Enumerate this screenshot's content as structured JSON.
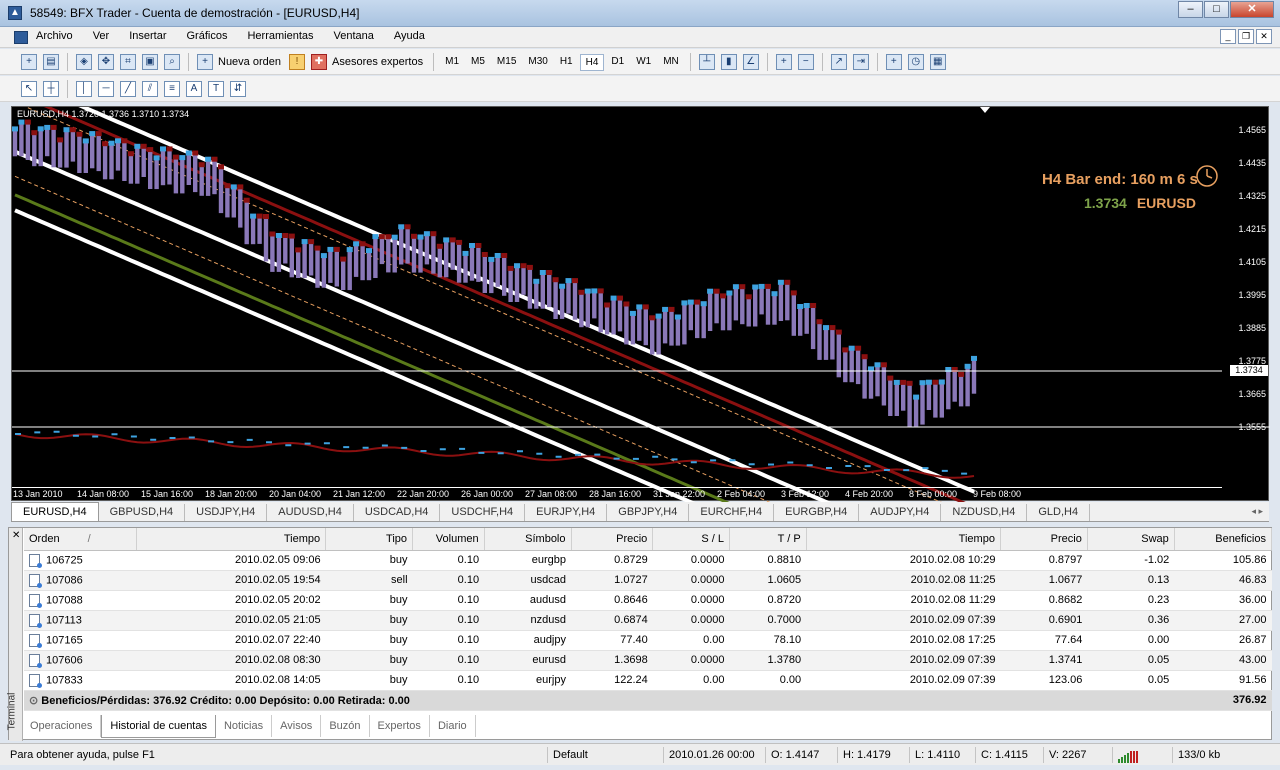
{
  "window": {
    "title": "58549: BFX Trader - Cuenta de demostración - [EURUSD,H4]"
  },
  "menu": [
    "Archivo",
    "Ver",
    "Insertar",
    "Gráficos",
    "Herramientas",
    "Ventana",
    "Ayuda"
  ],
  "toolbar": {
    "new_order": "Nueva orden",
    "expert_advisors": "Asesores expertos",
    "timeframes": [
      "M1",
      "M5",
      "M15",
      "M30",
      "H1",
      "H4",
      "D1",
      "W1",
      "MN"
    ],
    "active_timeframe": "H4"
  },
  "chart": {
    "header": "EURUSD,H4  1.3720 1.3736 1.3710 1.3734",
    "bar_end": "H4 Bar end: 160 m 6 s",
    "last_price": "1.3734",
    "last_symbol": "EURUSD",
    "current_price_label": "1.3734",
    "y_ticks": [
      "1.4565",
      "1.4435",
      "1.4325",
      "1.4215",
      "1.4105",
      "1.3995",
      "1.3885",
      "1.3775",
      "1.3665",
      "1.3555"
    ],
    "x_ticks": [
      "13 Jan 2010",
      "14 Jan 08:00",
      "15 Jan 16:00",
      "18 Jan 20:00",
      "20 Jan 04:00",
      "21 Jan 12:00",
      "22 Jan 20:00",
      "26 Jan 00:00",
      "27 Jan 08:00",
      "28 Jan 16:00",
      "31 Jan 22:00",
      "2 Feb 04:00",
      "3 Feb 12:00",
      "4 Feb 20:00",
      "8 Feb 00:00",
      "9 Feb 08:00"
    ],
    "colors": {
      "bull": "#3ea3e0",
      "bear": "#8b1010",
      "body": "#8a78b8",
      "band": "#ffffff",
      "green": "#5a7a1a"
    }
  },
  "chart_data": {
    "type": "line",
    "title": "EURUSD,H4",
    "ylim": [
      1.3555,
      1.4565
    ],
    "x": [
      "13 Jan 2010",
      "14 Jan 08:00",
      "15 Jan 16:00",
      "18 Jan 20:00",
      "20 Jan 04:00",
      "21 Jan 12:00",
      "22 Jan 20:00",
      "26 Jan 00:00",
      "27 Jan 08:00",
      "28 Jan 16:00",
      "31 Jan 22:00",
      "2 Feb 04:00",
      "3 Feb 12:00",
      "4 Feb 20:00",
      "8 Feb 00:00",
      "9 Feb 08:00"
    ],
    "series": [
      {
        "name": "EURUSD",
        "values": [
          1.45,
          1.447,
          1.442,
          1.439,
          1.415,
          1.408,
          1.416,
          1.411,
          1.403,
          1.396,
          1.388,
          1.396,
          1.398,
          1.378,
          1.364,
          1.3734
        ]
      }
    ]
  },
  "symbol_tabs": [
    "EURUSD,H4",
    "GBPUSD,H4",
    "USDJPY,H4",
    "AUDUSD,H4",
    "USDCAD,H4",
    "USDCHF,H4",
    "EURJPY,H4",
    "GBPJPY,H4",
    "EURCHF,H4",
    "EURGBP,H4",
    "AUDJPY,H4",
    "NZDUSD,H4",
    "GLD,H4"
  ],
  "terminal": {
    "side_label": "Terminal",
    "columns": [
      "Orden",
      "Tiempo",
      "Tipo",
      "Volumen",
      "Símbolo",
      "Precio",
      "S / L",
      "T / P",
      "Tiempo",
      "Precio",
      "Swap",
      "Beneficios"
    ],
    "sort_indicator": "/",
    "rows": [
      [
        "106725",
        "2010.02.05 09:06",
        "buy",
        "0.10",
        "eurgbp",
        "0.8729",
        "0.0000",
        "0.8810",
        "2010.02.08 10:29",
        "0.8797",
        "-1.02",
        "105.86"
      ],
      [
        "107086",
        "2010.02.05 19:54",
        "sell",
        "0.10",
        "usdcad",
        "1.0727",
        "0.0000",
        "1.0605",
        "2010.02.08 11:25",
        "1.0677",
        "0.13",
        "46.83"
      ],
      [
        "107088",
        "2010.02.05 20:02",
        "buy",
        "0.10",
        "audusd",
        "0.8646",
        "0.0000",
        "0.8720",
        "2010.02.08 11:29",
        "0.8682",
        "0.23",
        "36.00"
      ],
      [
        "107113",
        "2010.02.05 21:05",
        "buy",
        "0.10",
        "nzdusd",
        "0.6874",
        "0.0000",
        "0.7000",
        "2010.02.09 07:39",
        "0.6901",
        "0.36",
        "27.00"
      ],
      [
        "107165",
        "2010.02.07 22:40",
        "buy",
        "0.10",
        "audjpy",
        "77.40",
        "0.00",
        "78.10",
        "2010.02.08 17:25",
        "77.64",
        "0.00",
        "26.87"
      ],
      [
        "107606",
        "2010.02.08 08:30",
        "buy",
        "0.10",
        "eurusd",
        "1.3698",
        "0.0000",
        "1.3780",
        "2010.02.09 07:39",
        "1.3741",
        "0.05",
        "43.00"
      ],
      [
        "107833",
        "2010.02.08 14:05",
        "buy",
        "0.10",
        "eurjpy",
        "122.24",
        "0.00",
        "0.00",
        "2010.02.09 07:39",
        "123.06",
        "0.05",
        "91.56"
      ]
    ],
    "summary": "Beneficios/Pérdidas: 376.92  Crédito: 0.00  Depósito: 0.00  Retirada: 0.00",
    "summary_total": "376.92",
    "tabs": [
      "Operaciones",
      "Historial de cuentas",
      "Noticias",
      "Avisos",
      "Buzón",
      "Expertos",
      "Diario"
    ],
    "active_tab": "Historial de cuentas"
  },
  "status": {
    "help": "Para obtener ayuda, pulse F1",
    "profile": "Default",
    "datetime": "2010.01.26 00:00",
    "open": "O: 1.4147",
    "high": "H: 1.4179",
    "low": "L: 1.4110",
    "close": "C: 1.4115",
    "volume": "V: 2267",
    "traffic": "133/0 kb"
  }
}
